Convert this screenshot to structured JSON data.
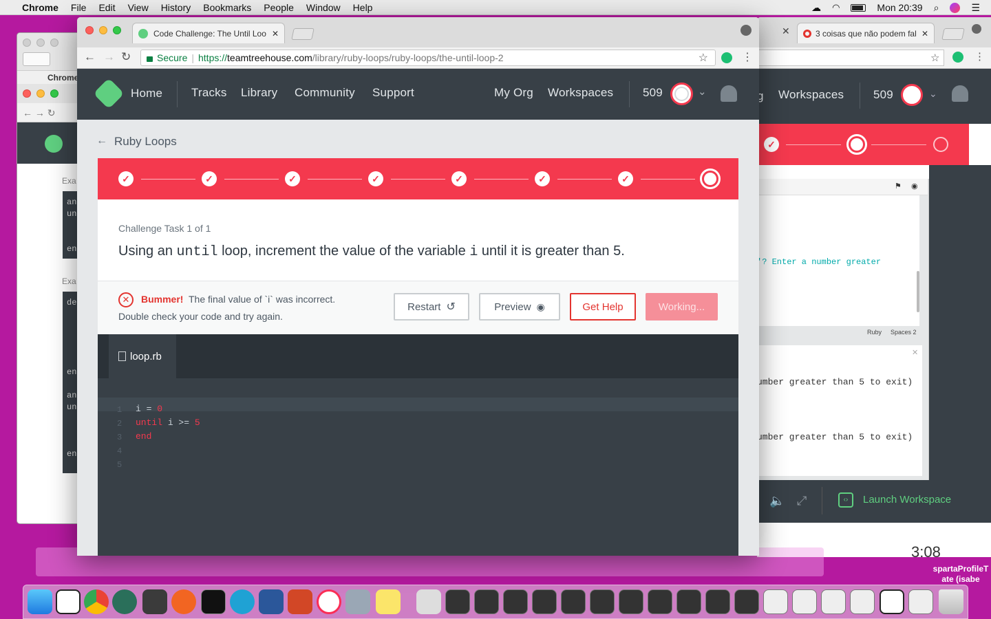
{
  "menubar": {
    "app": "Chrome",
    "items": [
      "File",
      "Edit",
      "View",
      "History",
      "Bookmarks",
      "People",
      "Window",
      "Help"
    ],
    "clock": "Mon 20:39"
  },
  "browser": {
    "tab_title": "Code Challenge: The Until Loo",
    "secure_label": "Secure",
    "url_scheme": "https://",
    "url_host": "teamtreehouse.com",
    "url_path": "/library/ruby-loops/ruby-loops/the-until-loop-2"
  },
  "nav": {
    "home": "Home",
    "links": [
      "Tracks",
      "Library",
      "Community",
      "Support"
    ],
    "right_links": [
      "My Org",
      "Workspaces"
    ],
    "points": "509"
  },
  "challenge": {
    "back_label": "Ruby Loops",
    "task_label": "Challenge Task 1 of 1",
    "q_part1": "Using an",
    "q_code1": "until",
    "q_part2": "loop, increment the value of the variable",
    "q_code2": "i",
    "q_part3": "until it is greater than 5.",
    "error_title": "Bummer!",
    "error_msg": "The final value of `i` was incorrect.",
    "error_hint": "Double check your code and try again.",
    "restart": "Restart",
    "preview": "Preview",
    "get_help": "Get Help",
    "working": "Working..."
  },
  "editor": {
    "file_tab": "loop.rb",
    "line_numbers": [
      "1",
      "2",
      "3",
      "4",
      "5"
    ],
    "lines": [
      {
        "a": "i",
        "b": " = ",
        "c": "0"
      },
      {
        "a": "until",
        "b": " i ",
        "c": ">=",
        "d": " 5"
      },
      {
        "a": "end"
      }
    ]
  },
  "right_window": {
    "tab_title": "3 coisas que não podem fal",
    "nav_link": "Workspaces",
    "nav_partial": "g",
    "points": "509",
    "console_line1": "'? Enter a number greater",
    "lang": "Ruby",
    "spaces": "Spaces 2",
    "output1": "umber greater than 5 to exit)",
    "output2": "umber greater than 5 to exit)",
    "launch": "Launch Workspace",
    "time_partial": "3:08"
  },
  "left_window": {
    "app_label": "Chrome",
    "ex1": "Exa",
    "ex2": "Exa",
    "code_a": [
      "an",
      "un",
      "en"
    ],
    "code_b": "de",
    "code_c": [
      "en",
      "an",
      "un",
      "en"
    ]
  },
  "desktop": {
    "file_label1": "spartaProfileT",
    "file_label2": "ate (isabe"
  },
  "colors": {
    "accent": "#f4394e",
    "nav": "#384047",
    "green": "#5fcf80"
  }
}
